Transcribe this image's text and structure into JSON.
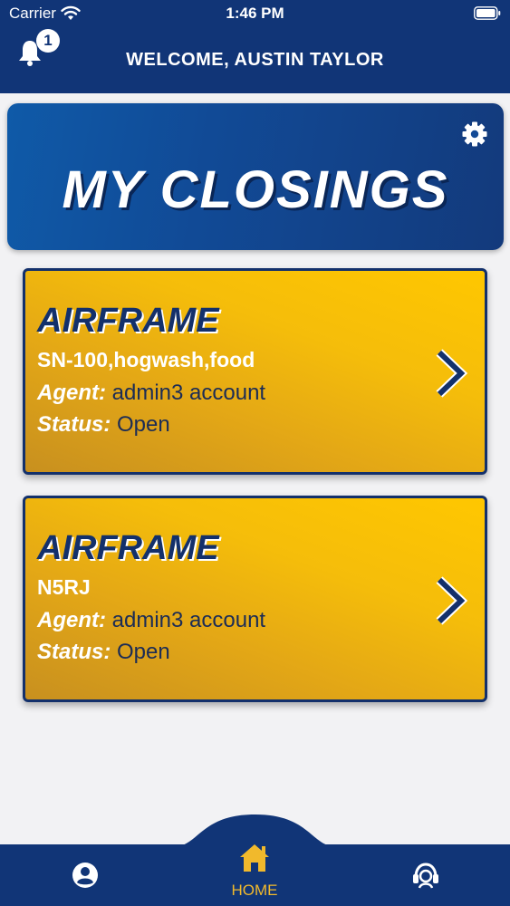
{
  "status_bar": {
    "carrier": "Carrier",
    "time": "1:46 PM"
  },
  "header": {
    "welcome": "WELCOME, AUSTIN TAYLOR",
    "notification_count": "1"
  },
  "banner": {
    "title": "MY CLOSINGS"
  },
  "closings": [
    {
      "type": "AIRFRAME",
      "serial": "SN-100,hogwash,food",
      "agent_label": "Agent:",
      "agent": "admin3 account",
      "status_label": "Status:",
      "status": "Open"
    },
    {
      "type": "AIRFRAME",
      "serial": "N5RJ",
      "agent_label": "Agent:",
      "agent": "admin3 account",
      "status_label": "Status:",
      "status": "Open"
    }
  ],
  "tabbar": {
    "home_label": "HOME",
    "icons": [
      "profile-icon",
      "home-icon",
      "support-icon"
    ]
  },
  "colors": {
    "navy": "#113577",
    "gold": "#f5bd0a",
    "home_accent": "#f1b92c"
  }
}
